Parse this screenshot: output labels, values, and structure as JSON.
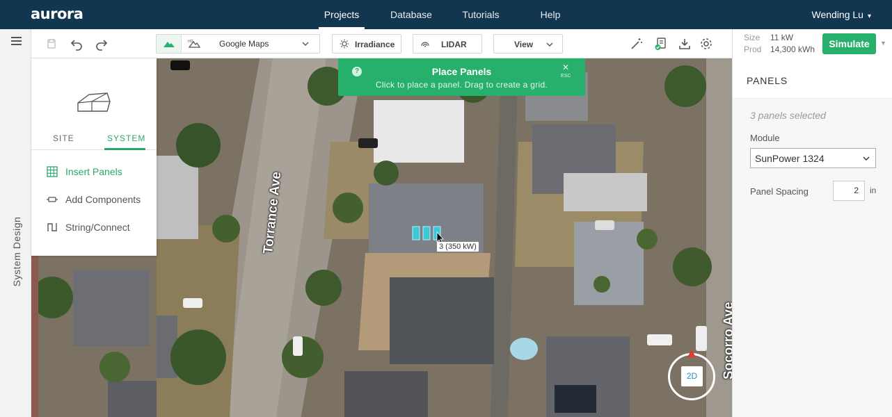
{
  "app": {
    "logo": "aurora"
  },
  "nav": {
    "items": [
      "Projects",
      "Database",
      "Tutorials",
      "Help"
    ],
    "active": "Projects",
    "user": "Wending Lu"
  },
  "sidebar": {
    "label": "System Design"
  },
  "toolbar": {
    "imagery_source": "Google Maps",
    "irradiance_label": "Irradiance",
    "lidar_label": "LIDAR",
    "view_label": "View"
  },
  "site_panel": {
    "tabs": [
      "SITE",
      "SYSTEM"
    ],
    "active_tab": "SYSTEM",
    "tools": [
      "Insert Panels",
      "Add Components",
      "String/Connect"
    ],
    "active_tool": "Insert Panels"
  },
  "toast": {
    "title": "Place Panels",
    "subtitle": "Click to place a panel. Drag to create a grid.",
    "help": "?",
    "close": "✕",
    "esc": "ESC"
  },
  "map": {
    "streets": [
      "Torrance Ave",
      "Socorro Ave"
    ],
    "panel_tooltip": "3 (350 kW)",
    "view_mode": "2D"
  },
  "right_panel": {
    "size_label": "Size",
    "size_value": "11 kW",
    "prod_label": "Prod",
    "prod_value": "14,300 kWh",
    "simulate_label": "Simulate",
    "section_title": "PANELS",
    "selected_text": "3 panels selected",
    "module_label": "Module",
    "module_value": "SunPower 1324",
    "spacing_label": "Panel Spacing",
    "spacing_value": "2",
    "spacing_unit": "in"
  },
  "colors": {
    "nav_bg": "#123550",
    "accent_green": "#27b06b",
    "compass_north": "#e53935"
  }
}
